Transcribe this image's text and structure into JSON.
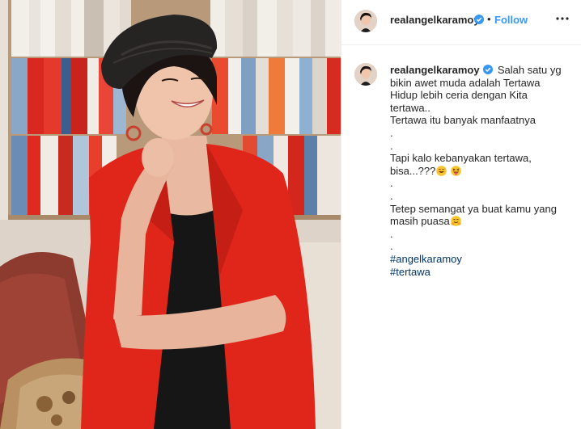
{
  "post": {
    "username": "realangelkaramoy",
    "verified_icon": "verified-badge-icon",
    "separator": "•",
    "follow_label": "Follow",
    "more_icon": "more-options-icon",
    "caption": {
      "first_line": "Salah satu yg",
      "lines": [
        "bikin awet muda adalah Tertawa",
        "Hidup lebih ceria dengan Kita",
        "tertawa..",
        "Tertawa itu banyak manfaatnya",
        ".",
        ".",
        "Tapi kalo kebanyakan tertawa,",
        "bisa...???",
        ".",
        ".",
        "Tetep semangat ya buat kamu yang",
        "masih puasa",
        ".",
        "."
      ],
      "emojis": [
        "grinning-sweat-emoji",
        "squinting-tongue-emoji",
        "hugging-face-emoji"
      ],
      "hashtags": [
        "#angelkaramoy",
        "#tertawa"
      ]
    }
  },
  "colors": {
    "link": "#3897f0",
    "hashtag": "#003569",
    "text": "#262626",
    "jacket": "#e0261b"
  }
}
